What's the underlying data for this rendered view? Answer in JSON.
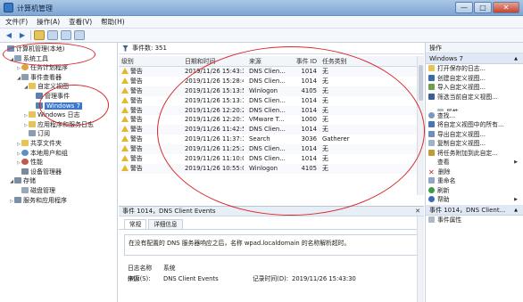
{
  "window": {
    "title": "计算机管理",
    "min_label": "—",
    "max_label": "□",
    "close_label": "✕"
  },
  "menu": [
    "文件(F)",
    "操作(A)",
    "查看(V)",
    "帮助(H)"
  ],
  "toolbar": {
    "back": "◀",
    "forward": "▶"
  },
  "tree": [
    {
      "label": "计算机管理(本地)",
      "icon": "computer-icon",
      "level": 0,
      "twisty": ""
    },
    {
      "label": "系统工具",
      "icon": "tools-icon",
      "level": 1,
      "twisty": "◢"
    },
    {
      "label": "任务计划程序",
      "icon": "clock-icon",
      "level": 2,
      "twisty": "▷"
    },
    {
      "label": "事件查看器",
      "icon": "log-icon",
      "level": 2,
      "twisty": "◢"
    },
    {
      "label": "自定义视图",
      "icon": "folder-icon",
      "level": 3,
      "twisty": "◢"
    },
    {
      "label": "管理事件",
      "icon": "filter-icon",
      "level": 4,
      "twisty": ""
    },
    {
      "label": "Windows 7",
      "icon": "filter-icon",
      "level": 4,
      "twisty": "",
      "selected": true
    },
    {
      "label": "Windows 日志",
      "icon": "folder-icon",
      "level": 3,
      "twisty": "▷"
    },
    {
      "label": "应用程序和服务日志",
      "icon": "folder-icon",
      "level": 3,
      "twisty": "▷"
    },
    {
      "label": "订阅",
      "icon": "log-icon",
      "level": 3,
      "twisty": ""
    },
    {
      "label": "共享文件夹",
      "icon": "share-icon",
      "level": 2,
      "twisty": "▷"
    },
    {
      "label": "本地用户和组",
      "icon": "users-icon",
      "level": 2,
      "twisty": "▷"
    },
    {
      "label": "性能",
      "icon": "perf-icon",
      "level": 2,
      "twisty": "▷"
    },
    {
      "label": "设备管理器",
      "icon": "device-icon",
      "level": 2,
      "twisty": ""
    },
    {
      "label": "存储",
      "icon": "storage-icon",
      "level": 1,
      "twisty": "◢"
    },
    {
      "label": "磁盘管理",
      "icon": "disk-icon",
      "level": 2,
      "twisty": ""
    },
    {
      "label": "服务和应用程序",
      "icon": "service-icon",
      "level": 1,
      "twisty": "▷"
    }
  ],
  "center": {
    "title": "Windows 7",
    "count_label": "事件数: 351",
    "columns": [
      "级别",
      "日期和时间",
      "来源",
      "事件 ID",
      "任务类别"
    ],
    "rows": [
      {
        "level": "警告",
        "datetime": "2019/11/26 15:43:30",
        "source": "DNS Clien...",
        "id": "1014",
        "task": "无"
      },
      {
        "level": "警告",
        "datetime": "2019/11/26 15:28:47",
        "source": "DNS Clien...",
        "id": "1014",
        "task": "无"
      },
      {
        "level": "警告",
        "datetime": "2019/11/26 15:13:53",
        "source": "Winlogon",
        "id": "4105",
        "task": "无"
      },
      {
        "level": "警告",
        "datetime": "2019/11/26 15:13:15",
        "source": "DNS Clien...",
        "id": "1014",
        "task": "无"
      },
      {
        "level": "警告",
        "datetime": "2019/11/26 12:20:27",
        "source": "DNS Clien...",
        "id": "1014",
        "task": "无"
      },
      {
        "level": "警告",
        "datetime": "2019/11/26 12:20:18",
        "source": "VMware T...",
        "id": "1000",
        "task": "无"
      },
      {
        "level": "警告",
        "datetime": "2019/11/26 11:42:56",
        "source": "DNS Clien...",
        "id": "1014",
        "task": "无"
      },
      {
        "level": "警告",
        "datetime": "2019/11/26 11:37:16",
        "source": "Search",
        "id": "3036",
        "task": "Gatherer"
      },
      {
        "level": "警告",
        "datetime": "2019/11/26 11:25:22",
        "source": "DNS Clien...",
        "id": "1014",
        "task": "无"
      },
      {
        "level": "警告",
        "datetime": "2019/11/26 11:10:04",
        "source": "DNS Clien...",
        "id": "1014",
        "task": "无"
      },
      {
        "level": "警告",
        "datetime": "2019/11/26 10:55:09",
        "source": "Winlogon",
        "id": "4105",
        "task": "无"
      }
    ]
  },
  "detail": {
    "title": "事件 1014，DNS Client Events",
    "close_label": "✕",
    "tabs": [
      "常规",
      "详细信息"
    ],
    "message": "在没有配置的 DNS 服务器响应之后，名称 wpad.localdomain 的名称解析超时。",
    "log_name_label": "日志名称(M):",
    "log_name_value": "系统",
    "source_label": "来源(S):",
    "source_value": "DNS Client Events",
    "logged_label": "记录时间(D):",
    "logged_value": "2019/11/26 15:43:30"
  },
  "actions": {
    "header": "操作",
    "section1": "Windows 7",
    "items1": [
      {
        "label": "打开保存的日志...",
        "icon": "open-icon"
      },
      {
        "label": "创建自定义视图...",
        "icon": "filter-create-icon"
      },
      {
        "label": "导入自定义视图...",
        "icon": "import-icon"
      },
      {
        "label": "筛选当前自定义视图...",
        "icon": "funnel-icon"
      },
      {
        "label": "属性",
        "icon": "properties-icon"
      },
      {
        "label": "查找...",
        "icon": "find-icon"
      },
      {
        "label": "将自定义视图中的所有...",
        "icon": "save-icon"
      },
      {
        "label": "导出自定义视图...",
        "icon": "export-icon"
      },
      {
        "label": "复制自定义视图...",
        "icon": "copy-icon"
      },
      {
        "label": "将任务附加到此自定...",
        "icon": "attach-icon"
      },
      {
        "label": "查看",
        "icon": "view-icon",
        "submenu": true
      },
      {
        "label": "删除",
        "icon": "delete-icon"
      },
      {
        "label": "重命名",
        "icon": "rename-icon"
      },
      {
        "label": "刷新",
        "icon": "refresh-icon"
      },
      {
        "label": "帮助",
        "icon": "help-icon",
        "submenu": true
      }
    ],
    "section2": "事件 1014，DNS Client...",
    "items2": [
      {
        "label": "事件属性",
        "icon": "event-properties-icon"
      }
    ]
  },
  "colors": {
    "annotation": "#d8282a",
    "selection": "#3a78d3",
    "warning": "#e5b829"
  }
}
